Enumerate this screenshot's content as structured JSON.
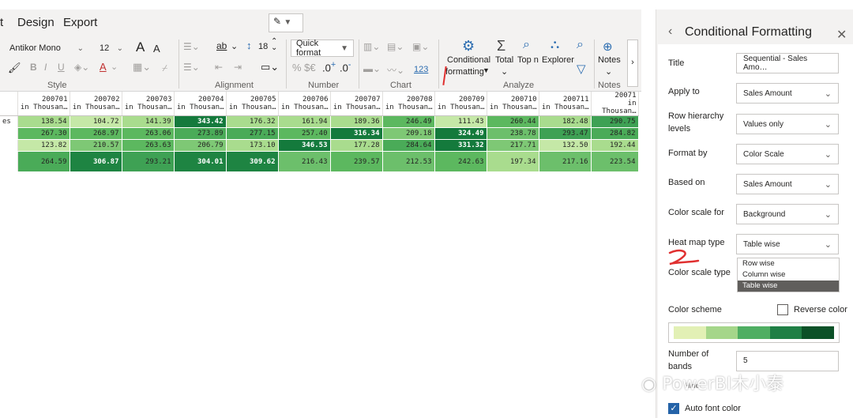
{
  "menu": {
    "items": [
      "t",
      "Design",
      "Export"
    ]
  },
  "ribbon": {
    "font_name": "Antikor Mono",
    "font_size": "12",
    "font_grow": "A",
    "font_shrink": "A",
    "format_quick": "Quick format",
    "line_value": "18",
    "percent_symbols": "% $€",
    "decimals_up": ".0",
    "decimals_down": ".0",
    "chart_number": "123",
    "wrap_label": "ab",
    "cond_label_line1": "Conditional",
    "cond_label_line2": "formatting",
    "total_label": "Total",
    "topn_label": "Top n",
    "explorer_label": "Explorer",
    "notes_label": "Notes",
    "groups": {
      "style": "Style",
      "alignment": "Alignment",
      "number": "Number",
      "chart": "Chart",
      "analyze": "Analyze",
      "notes": "Notes"
    }
  },
  "matrix": {
    "columns": [
      "200701",
      "200702",
      "200703",
      "200704",
      "200705",
      "200706",
      "200707",
      "200708",
      "200709",
      "200710",
      "200711",
      "20071"
    ],
    "units_label": [
      "in Thousan…",
      "in Thousan…",
      "in Thousan…",
      "in Thousan…",
      "in Thousan…",
      "in Thousan…",
      "in Thousan…",
      "in Thousan…",
      "in Thousan…",
      "in Thousan…",
      "in Thousan…",
      "in Thousan…"
    ],
    "rows": [
      {
        "label": "es",
        "values": [
          "138.54",
          "104.72",
          "141.39",
          "343.42",
          "176.32",
          "161.94",
          "189.36",
          "246.49",
          "111.43",
          "260.44",
          "182.48",
          "290.75"
        ],
        "colors": [
          "#a9dc8e",
          "#c5e8a7",
          "#a9dc8e",
          "#147a3c",
          "#a9dc8e",
          "#a9dc8e",
          "#a9dc8e",
          "#5cb85f",
          "#c5e8a7",
          "#5cb85f",
          "#a9dc8e",
          "#3ea154"
        ]
      },
      {
        "label": "",
        "values": [
          "267.30",
          "268.97",
          "263.06",
          "273.89",
          "277.15",
          "257.40",
          "316.34",
          "209.18",
          "324.49",
          "238.78",
          "293.47",
          "284.82"
        ],
        "colors": [
          "#5cb85f",
          "#5cb85f",
          "#5cb85f",
          "#4aab58",
          "#4aab58",
          "#5cb85f",
          "#147a3c",
          "#7ec875",
          "#147a3c",
          "#6cbf6b",
          "#3ea154",
          "#4aab58"
        ]
      },
      {
        "label": "",
        "values": [
          "123.82",
          "210.57",
          "263.63",
          "206.79",
          "173.10",
          "346.53",
          "177.28",
          "284.64",
          "331.32",
          "217.71",
          "132.50",
          "192.44"
        ],
        "colors": [
          "#c5e8a7",
          "#7ec875",
          "#5cb85f",
          "#7ec875",
          "#a9dc8e",
          "#147a3c",
          "#a9dc8e",
          "#4aab58",
          "#147a3c",
          "#7ec875",
          "#c5e8a7",
          "#a9dc8e"
        ]
      },
      {
        "label": "",
        "values": [
          "264.59",
          "306.87",
          "293.21",
          "304.01",
          "309.62",
          "216.43",
          "239.57",
          "212.53",
          "242.63",
          "197.34",
          "217.16",
          "223.54"
        ],
        "colors": [
          "#4aab58",
          "#1e8442",
          "#3ea154",
          "#1e8442",
          "#1e8442",
          "#6cbf6b",
          "#5cb85f",
          "#6cbf6b",
          "#5cb85f",
          "#a9dc8e",
          "#6cbf6b",
          "#6cbf6b"
        ]
      }
    ]
  },
  "pane": {
    "title": "Conditional Formatting",
    "fields": {
      "title_label": "Title",
      "title_value": "Sequential - Sales Amo…",
      "apply_label": "Apply to",
      "apply_value": "Sales Amount",
      "hier_label": "Row hierarchy levels",
      "hier_value": "Values only",
      "format_label": "Format by",
      "format_value": "Color Scale",
      "based_label": "Based on",
      "based_value": "Sales Amount",
      "scale_for_label": "Color scale for",
      "scale_for_value": "Background",
      "heat_label": "Heat map type",
      "heat_value": "Table wise",
      "scale_type_label": "Color scale type",
      "scheme_label": "Color scheme",
      "reverse_label": "Reverse color",
      "bands_label": "Number of bands",
      "bands_value": "5",
      "hide_label": "Hide",
      "auto_font_label": "Auto font color"
    },
    "heat_options": [
      "Row wise",
      "Column wise",
      "Table wise"
    ],
    "scheme_colors": [
      "#e2f0b5",
      "#a5d68a",
      "#4fae62",
      "#1f7f45",
      "#0b5127"
    ],
    "auto_font_checked": true,
    "reverse_checked": false
  },
  "watermark": "PowerBI木小泰"
}
